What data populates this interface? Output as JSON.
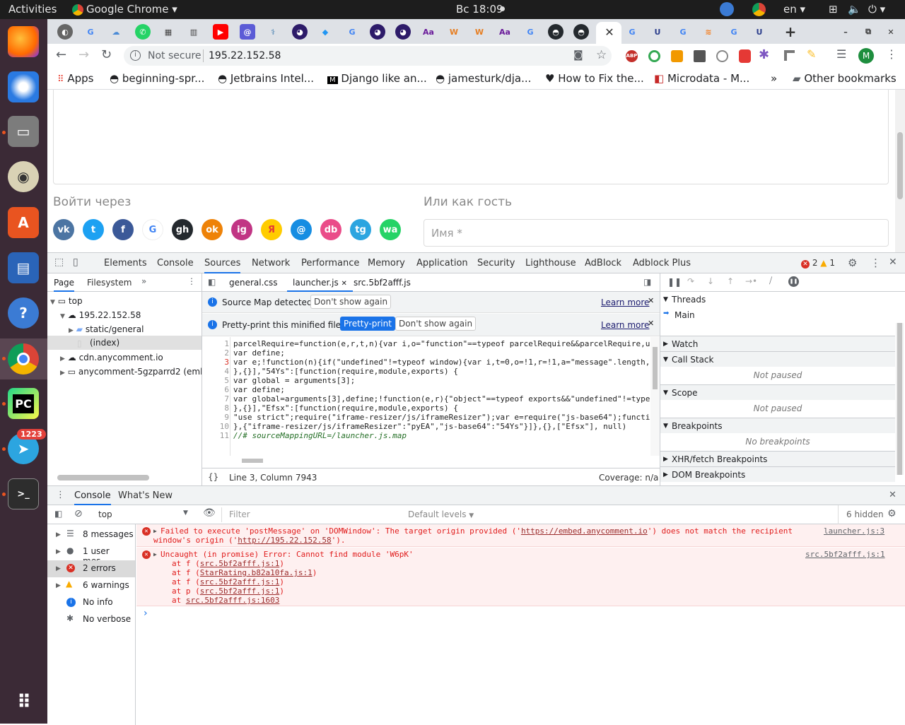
{
  "topbar": {
    "activities": "Activities",
    "app": "Google Chrome",
    "clock": "Вс 18:09",
    "lang": "en"
  },
  "dock": {
    "telegram_badge": "1223"
  },
  "bookmarks": {
    "apps": "Apps",
    "items": [
      "beginning-spr...",
      "Jetbrains Intel...",
      "Django like an...",
      "jamesturk/dja...",
      "How to Fix the...",
      "Microdata - M..."
    ],
    "overflow": "»",
    "other": "Other bookmarks"
  },
  "omnibox": {
    "security": "Not secure",
    "url": "195.22.152.58"
  },
  "page": {
    "login_via": "Войти через",
    "guest": "Или как гость",
    "name_placeholder": "Имя *",
    "socials": [
      {
        "label": "vk",
        "color": "#4c75a3"
      },
      {
        "label": "t",
        "color": "#1da1f2"
      },
      {
        "label": "f",
        "color": "#3b5998"
      },
      {
        "label": "G",
        "color": "#ffffff"
      },
      {
        "label": "gh",
        "color": "#24292e"
      },
      {
        "label": "ok",
        "color": "#ee8208"
      },
      {
        "label": "ig",
        "color": "#c13584"
      },
      {
        "label": "Я",
        "color": "#ffcc00"
      },
      {
        "label": "@",
        "color": "#168de2"
      },
      {
        "label": "db",
        "color": "#ea4c89"
      },
      {
        "label": "tg",
        "color": "#2ca5e0"
      },
      {
        "label": "wa",
        "color": "#25d366"
      }
    ]
  },
  "devtools": {
    "tabs": [
      "Elements",
      "Console",
      "Sources",
      "Network",
      "Performance",
      "Memory",
      "Application",
      "Security",
      "Lighthouse",
      "AdBlock",
      "Adblock Plus"
    ],
    "errors_count": "2",
    "warnings_count": "1",
    "nav_tabs": [
      "Page",
      "Filesystem"
    ],
    "tree": [
      "top",
      "195.22.152.58",
      "static/general",
      "(index)",
      "cdn.anycomment.io",
      "anycomment-5gzparrd2 (embed"
    ],
    "file_tabs": [
      "general.css",
      "launcher.js",
      "src.5bf2afff.js"
    ],
    "infobar1": {
      "text": "Source Map detected.",
      "button": "Don't show again",
      "link": "Learn more"
    },
    "infobar2": {
      "text": "Pretty-print this minified file?",
      "primary": "Pretty-print",
      "button": "Don't show again",
      "link": "Learn more"
    },
    "code_lines": [
      "parcelRequire=function(e,r,t,n){var i,o=\"function\"==typeof parcelRequire&&parcelRequire,u",
      "var define;",
      "var e;!function(n){if(\"undefined\"!=typeof window){var i,t=0,o=!1,r=!1,a=\"message\".length,",
      "},{}],\"54Ys\":[function(require,module,exports) {",
      "var global = arguments[3];",
      "var define;",
      "var global=arguments[3],define;!function(e,r){\"object\"==typeof exports&&\"undefined\"!=type",
      "},{}],\"Efsx\":[function(require,module,exports) {",
      "\"use strict\";require(\"iframe-resizer/js/iframeResizer\");var e=require(\"js-base64\");functi",
      "},{\"iframe-resizer/js/iframeResizer\":\"pyEA\",\"js-base64\":\"54Ys\"}]},{},[\"Efsx\"], null)",
      "//# sourceMappingURL=/launcher.js.map"
    ],
    "status": {
      "position": "Line 3, Column 7943",
      "coverage": "Coverage: n/a"
    },
    "side": {
      "threads": "Threads",
      "main": "Main",
      "watch": "Watch",
      "callstack": "Call Stack",
      "not_paused": "Not paused",
      "scope": "Scope",
      "breakpoints": "Breakpoints",
      "no_breakpoints": "No breakpoints",
      "xhr": "XHR/fetch Breakpoints",
      "dom": "DOM Breakpoints"
    }
  },
  "console": {
    "tabs": [
      "Console",
      "What's New"
    ],
    "context": "top",
    "filter_placeholder": "Filter",
    "levels": "Default levels",
    "hidden": "6 hidden",
    "sidebar": [
      "8 messages",
      "1 user mes...",
      "2 errors",
      "6 warnings",
      "No info",
      "No verbose"
    ],
    "msg1": {
      "text1": "Failed to execute 'postMessage' on 'DOMWindow': The target origin provided ('",
      "url1": "https://embed.anycomment.io",
      "text2": "') does not match the recipient",
      "text3": "window's origin ('",
      "url2": "http://195.22.152.58",
      "text4": "').",
      "source": "launcher.js:3"
    },
    "msg2": {
      "text": "Uncaught (in promise) Error: Cannot find module 'W6pK'",
      "source": "src.5bf2afff.js:1",
      "stack": [
        {
          "prefix": "at f (",
          "link": "src.5bf2afff.js:1",
          "suffix": ")"
        },
        {
          "prefix": "at f (",
          "link": "StarRating.b82a10fa.js:1",
          "suffix": ")"
        },
        {
          "prefix": "at f (",
          "link": "src.5bf2afff.js:1",
          "suffix": ")"
        },
        {
          "prefix": "at p (",
          "link": "src.5bf2afff.js:1",
          "suffix": ")"
        },
        {
          "prefix": "at ",
          "link": "src.5bf2afff.js:1603",
          "suffix": ""
        }
      ]
    },
    "prompt": "›"
  }
}
